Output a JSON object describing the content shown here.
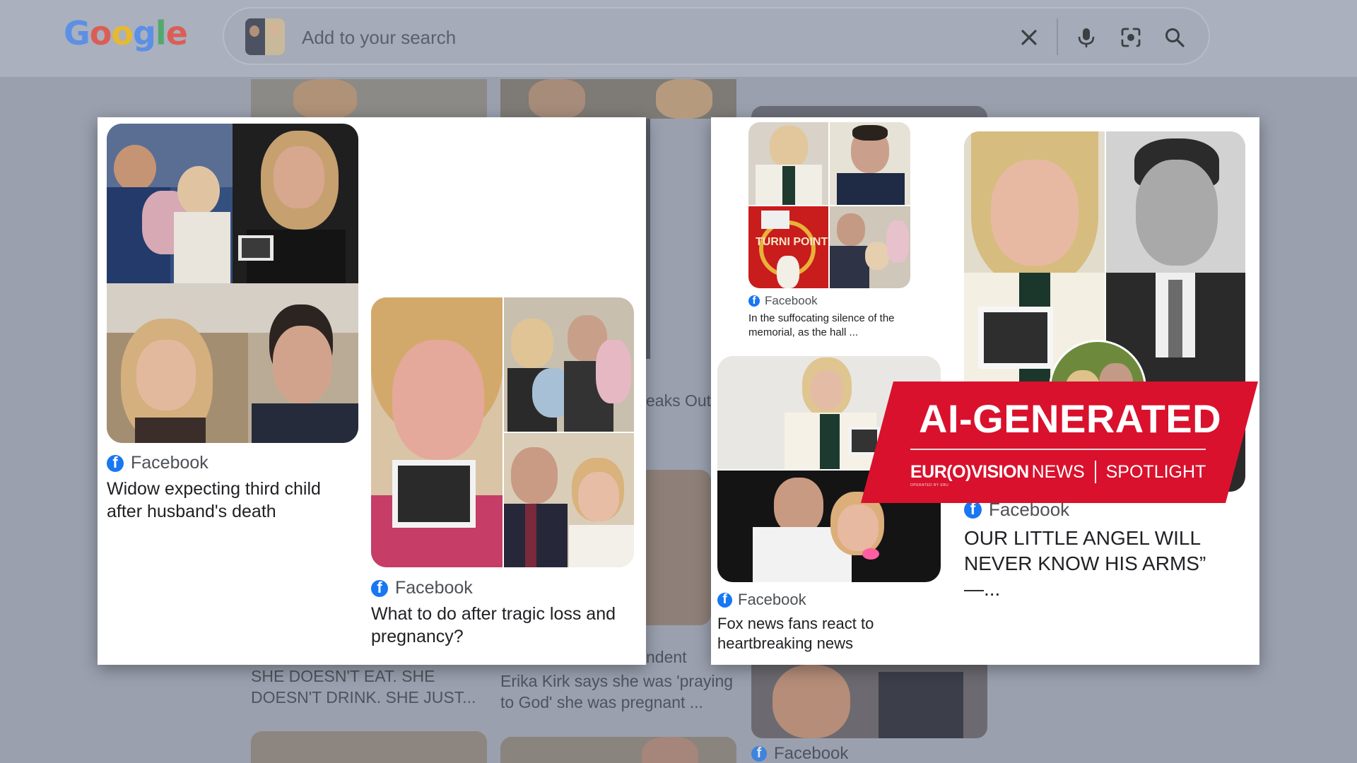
{
  "google": {
    "logo_letters": [
      {
        "char": "G",
        "color": "#4285f4"
      },
      {
        "char": "o",
        "color": "#ea4335"
      },
      {
        "char": "o",
        "color": "#fbbc05"
      },
      {
        "char": "g",
        "color": "#4285f4"
      },
      {
        "char": "l",
        "color": "#34a853"
      },
      {
        "char": "e",
        "color": "#ea4335"
      }
    ],
    "search_placeholder": "Add to your search",
    "icons": [
      "clear-icon",
      "microphone-icon",
      "lens-icon",
      "search-icon"
    ]
  },
  "background": {
    "snippet_1": "eaks Out",
    "snippet_2": "ndent",
    "caption_left": "SHE DOESN'T EAT. SHE\nDOESN'T DRINK. SHE JUST...",
    "caption_middle": "Erika Kirk says she was 'praying\nto God' she was pregnant ...",
    "fb_label": "Facebook"
  },
  "results": [
    {
      "source": "Facebook",
      "title": "Widow expecting third child after husband's death"
    },
    {
      "source": "Facebook",
      "title": "What to do after tragic loss and pregnancy?"
    },
    {
      "source": "Facebook",
      "title": "In the suffocating silence of the memorial, as the hall ..."
    },
    {
      "source": "Facebook",
      "title": "Fox news fans react to heartbreaking news"
    },
    {
      "source": "Facebook",
      "title": "OUR LITTLE ANGEL WILL NEVER KNOW HIS ARMS” —..."
    }
  ],
  "image_text": {
    "turning_point": "TURNI POINT"
  },
  "banner": {
    "title": "AI-GENERATED",
    "brand_a": "EUR(O)VISION",
    "brand_b": "NEWS",
    "brand_c": "SPOTLIGHT",
    "brand_sub": "OPERATED BY EBU",
    "color": "#d9112d"
  }
}
